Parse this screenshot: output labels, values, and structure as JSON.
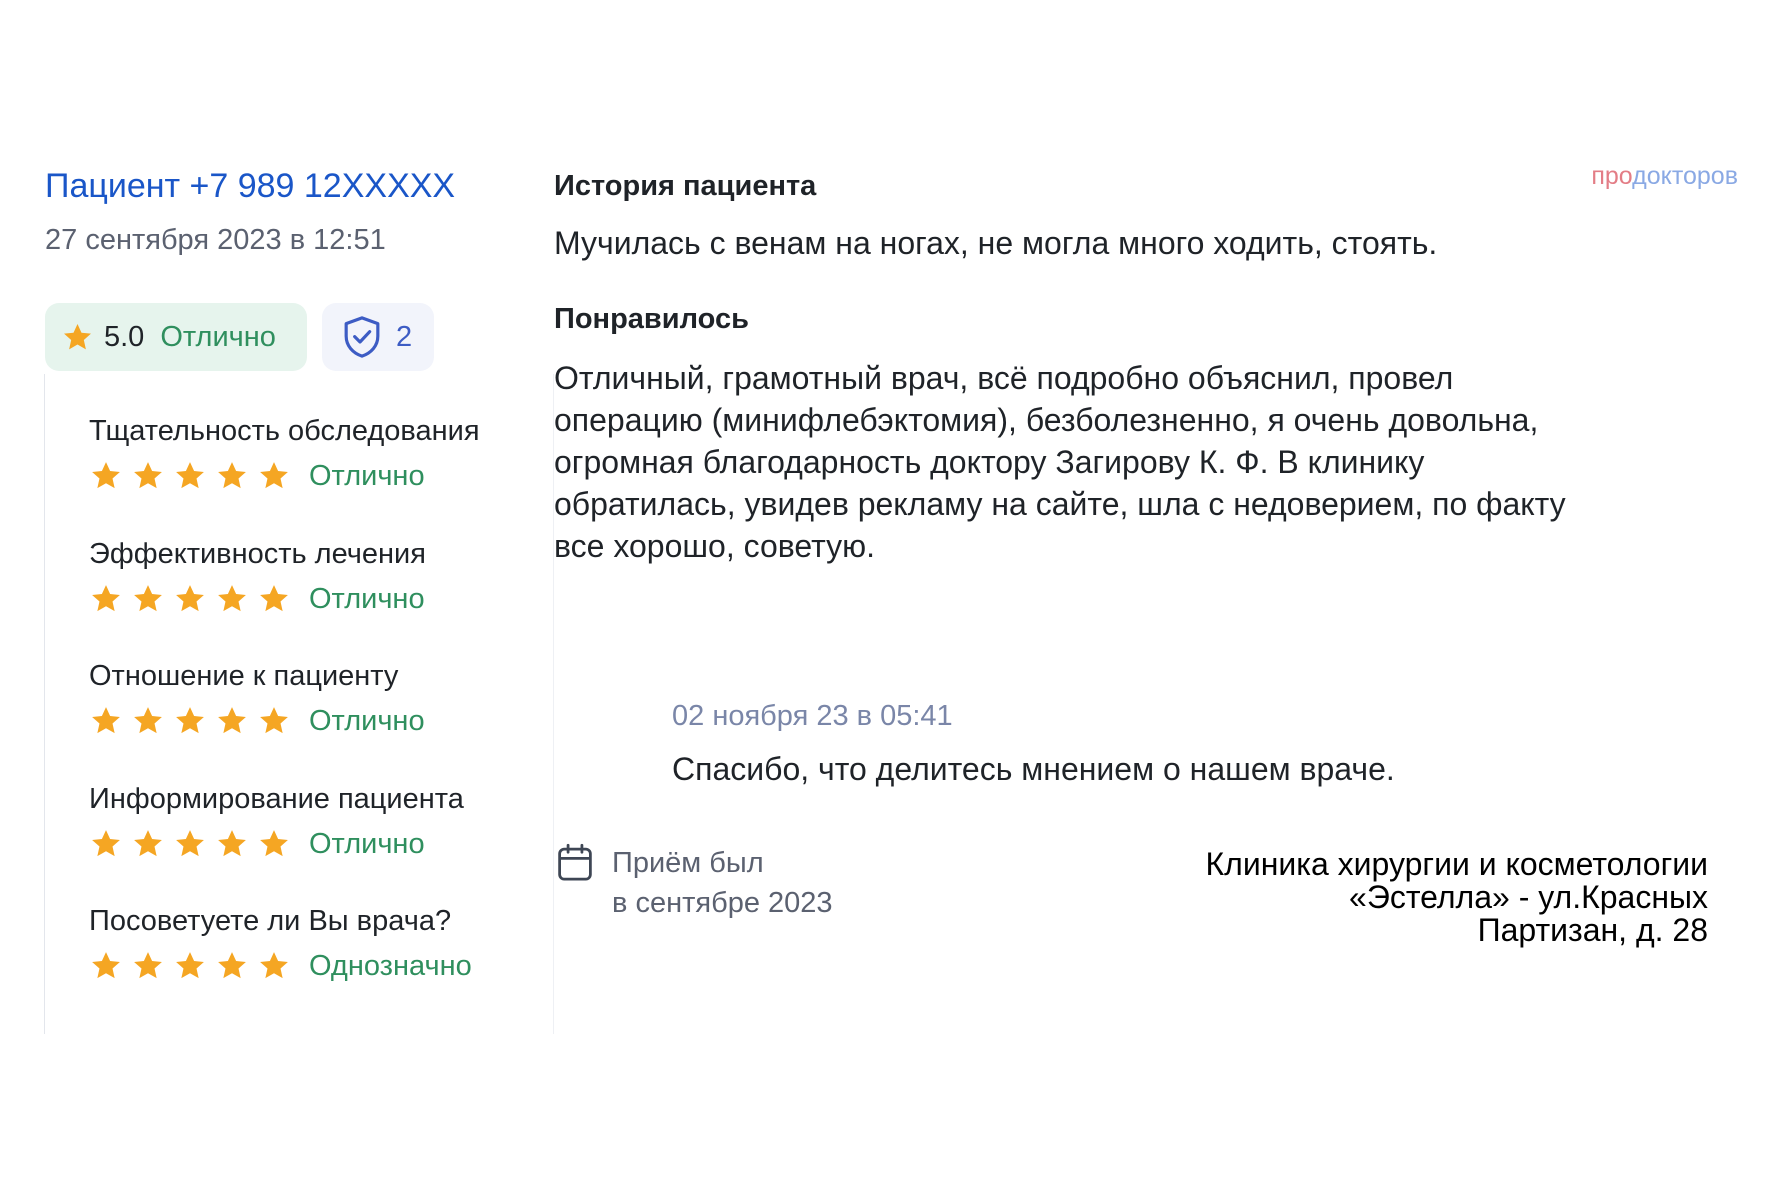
{
  "review": {
    "author": "Пациент +7 989 12XXXXX",
    "date": "27 сентября 2023 в 12:51",
    "rating_value": "5.0",
    "rating_word": "Отлично",
    "verified_count": "2"
  },
  "criteria": [
    {
      "label": "Тщательность обследования",
      "stars": 5,
      "rating": "Отлично"
    },
    {
      "label": "Эффективность лечения",
      "stars": 5,
      "rating": "Отлично"
    },
    {
      "label": "Отношение к пациенту",
      "stars": 5,
      "rating": "Отлично"
    },
    {
      "label": "Информирование пациента",
      "stars": 5,
      "rating": "Отлично"
    },
    {
      "label": "Посоветуете ли Вы врача?",
      "stars": 5,
      "rating": "Однозначно"
    }
  ],
  "history": {
    "title": "История пациента",
    "text": "Мучилась с венам на ногах, не могла много ходить, стоять."
  },
  "liked": {
    "title": "Понравилось",
    "lines": [
      "Отличный, грамотный врач, всё подробно объяснил, провел",
      "операцию (минифлебэктомия), безболезненно, я очень довольна,",
      "огромная благодарность доктору Загирову К. Ф. В клинику",
      "обратилась, увидев рекламу на сайте, шла с недоверием, по факту",
      "все хорошо, советую."
    ]
  },
  "brand": {
    "part1": "про",
    "part2": "докторов"
  },
  "reply": {
    "date": "02 ноября 23 в 05:41",
    "text": "Спасибо, что делитесь мнением о нашем враче."
  },
  "visit": {
    "line1": "Приём был",
    "line2": "в сентябре 2023"
  },
  "clinic": {
    "lines": [
      "Клиника хирургии и косметологии",
      "«Эстелла» - ул.Красных",
      "Партизан, д. 28"
    ]
  },
  "colors": {
    "link_blue": "#1a56c8",
    "star_orange": "#f5a623",
    "rating_green": "#2f8f5e",
    "rating_pill_bg": "#e6f4ed",
    "verified_pill_bg": "#f2f4fb"
  },
  "icons": {
    "rating": "star-icon",
    "verified": "shield-check-icon",
    "visit": "calendar-icon"
  }
}
